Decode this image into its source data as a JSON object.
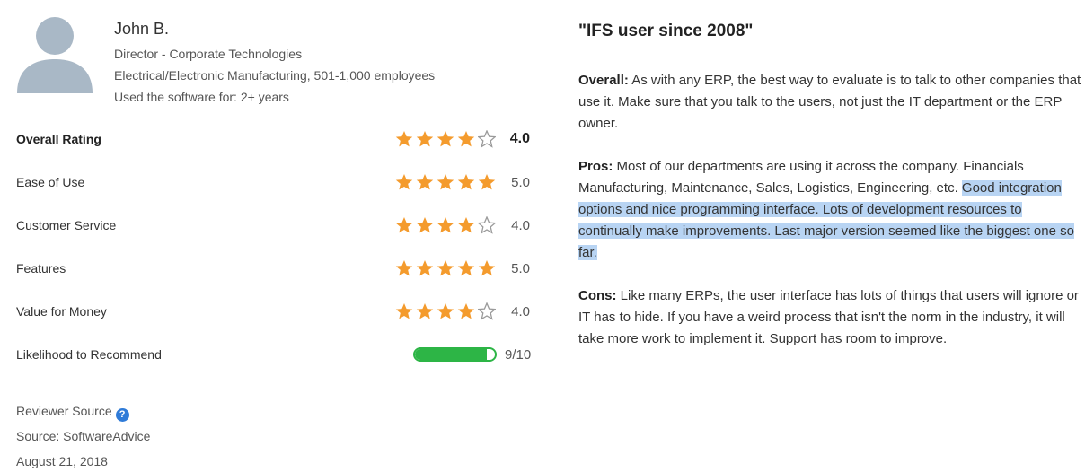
{
  "reviewer": {
    "name": "John B.",
    "title": "Director - Corporate Technologies",
    "company": "Electrical/Electronic Manufacturing, 501-1,000 employees",
    "usage": "Used the software for: 2+ years"
  },
  "ratings": [
    {
      "label": "Overall Rating",
      "stars": 4,
      "value": "4.0"
    },
    {
      "label": "Ease of Use",
      "stars": 5,
      "value": "5.0"
    },
    {
      "label": "Customer Service",
      "stars": 4,
      "value": "4.0"
    },
    {
      "label": "Features",
      "stars": 5,
      "value": "5.0"
    },
    {
      "label": "Value for Money",
      "stars": 4,
      "value": "4.0"
    }
  ],
  "recommend": {
    "label": "Likelihood to Recommend",
    "score": 9,
    "max": 10,
    "value": "9/10"
  },
  "source": {
    "reviewer_source_label": "Reviewer Source",
    "source_text": "Source: SoftwareAdvice",
    "date": "August 21, 2018"
  },
  "review": {
    "title": "\"IFS user since 2008\"",
    "overall_label": "Overall:",
    "overall_text": "As with any ERP, the best way to evaluate is to talk to other companies that use it. Make sure that you talk to the users, not just the IT department or the ERP owner.",
    "pros_label": "Pros:",
    "pros_text": "Most of our departments are using it across the company. Financials Manufacturing, Maintenance, Sales, Logistics, Engineering, etc. ",
    "pros_highlight": "Good integration options and nice programming interface. Lots of development resources to continually make improvements. Last major version seemed like the biggest one so far.",
    "cons_label": "Cons:",
    "cons_text": "Like many ERPs, the user interface has lots of things that users will ignore or IT has to hide. If you have a weird process that isn't the norm in the industry, it will take more work to implement it. Support has room to improve."
  },
  "colors": {
    "star": "#f49b2d",
    "star_empty": "#9a9a9a",
    "bar": "#2db546",
    "highlight": "#b8d4f3",
    "help_icon": "#2f7bd8"
  }
}
